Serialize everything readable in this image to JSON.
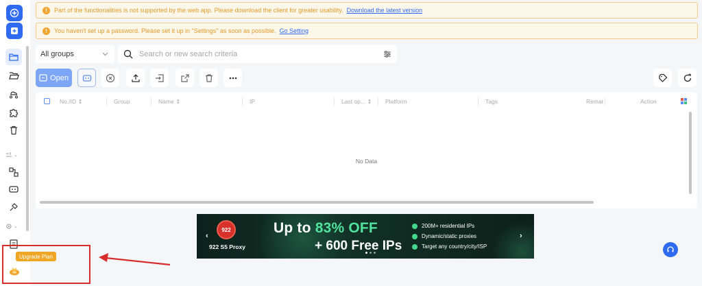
{
  "notices": [
    {
      "text": "Part of the functionalities is not supported by the web app. Please download the client for greater usability.",
      "link": "Download the latest version"
    },
    {
      "text": "You haven't set up a password. Please set it up in \"Settings\" as soon as possible.",
      "link": "Go Setting"
    }
  ],
  "filter": {
    "group_value": "All groups",
    "search_placeholder": "Search or new search criteria"
  },
  "toolbar": {
    "open_label": "Open"
  },
  "table": {
    "columns": [
      "No./ID",
      "Group",
      "Name",
      "IP",
      "Last op...",
      "Platform",
      "Tags",
      "Remar",
      "Action"
    ],
    "empty_text": "No Data"
  },
  "banner": {
    "logo": "922",
    "brand": "922 S5 Proxy",
    "headline_prefix": "Up to ",
    "headline_accent": "83% OFF",
    "subheadline": "+ 600 Free IPs",
    "bullets": [
      "200M+ residential IPs",
      "Dynamic/static proxies",
      "Target any country/city/ISP"
    ],
    "prev_arrow": "‹",
    "next_arrow": "›"
  },
  "sidebar": {
    "items": [
      "folder-icon",
      "folder-open-icon",
      "cloud-group-icon",
      "extension-icon",
      "trash-icon",
      "automation-icon",
      "rpa-icon",
      "api-icon",
      "settings-icon",
      "log-icon"
    ]
  },
  "upgrade": {
    "label": "Upgrade Plan"
  },
  "colors": {
    "primary": "#2f6bf1",
    "warning": "#f3a531",
    "annotation": "#d82d2d",
    "banner_accent": "#51e29b"
  }
}
